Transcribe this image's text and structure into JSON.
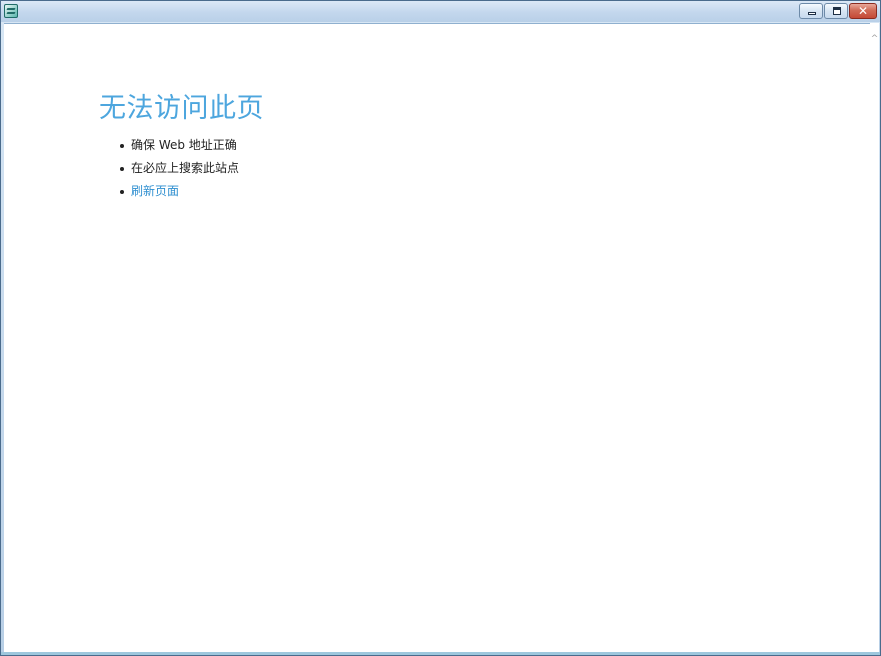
{
  "window": {
    "icon": "app-icon",
    "buttons": {
      "minimize_icon": "minimize-icon",
      "maximize_icon": "maximize-icon",
      "close_label": "✕"
    }
  },
  "page": {
    "title": "无法访问此页",
    "suggestions": [
      {
        "text": "确保 Web 地址正确",
        "link": false
      },
      {
        "text": "在必应上搜索此站点",
        "link": false
      },
      {
        "text": "刷新页面",
        "link": true
      }
    ]
  },
  "scrollbar": {
    "up_arrow": "^"
  },
  "colors": {
    "title": "#4da6de",
    "link": "#2f8fd0",
    "text": "#222222"
  }
}
